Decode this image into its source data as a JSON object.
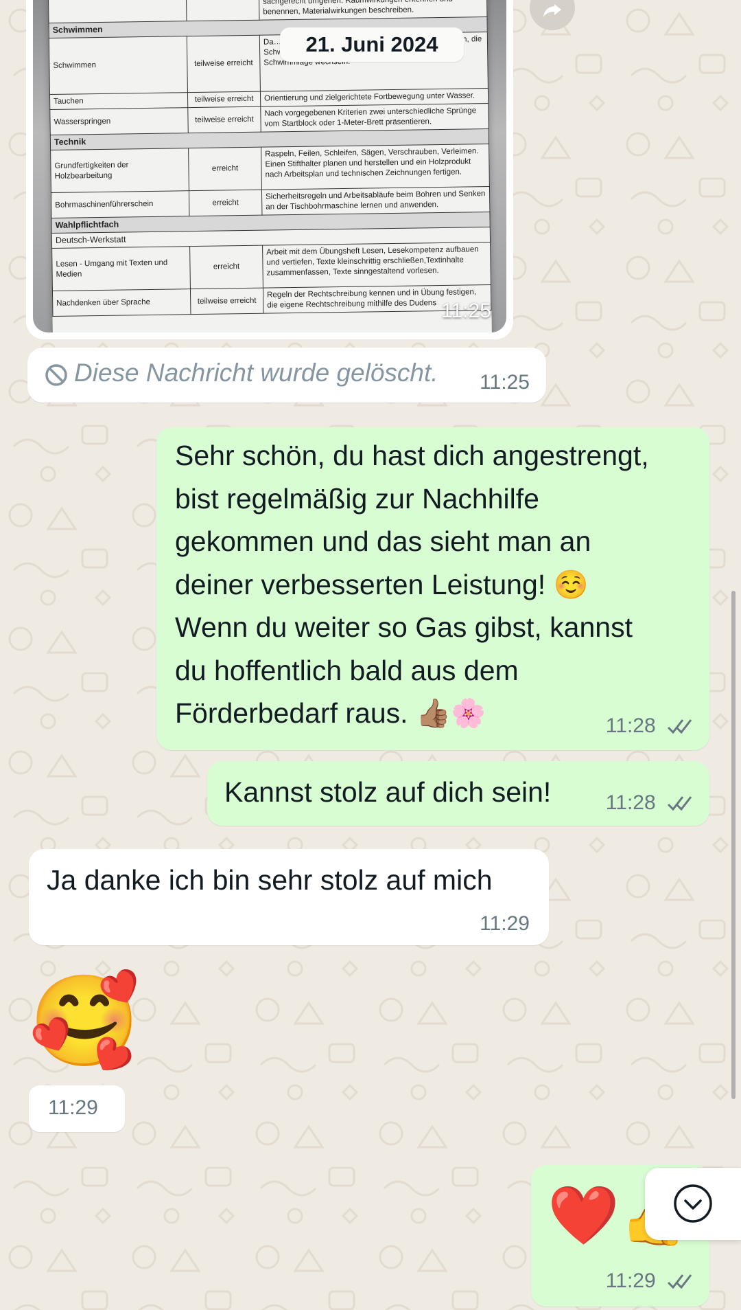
{
  "date_pill": "21. Juni 2024",
  "photo_message": {
    "time": "11:25",
    "document_rows": [
      {
        "type": "text",
        "name": "",
        "status": "",
        "desc": "sachgerecht umgehen. Raumwirkungen erkennen und benennen, Materialwirkungen beschreiben."
      },
      {
        "type": "section",
        "label": "Schwimmen"
      },
      {
        "type": "row",
        "name": "Schwimmen",
        "status": "teilweise erreicht",
        "desc": "Da… einen … vom Beckenrand oder Startblock ausführen, die Schwimmfähigkeit richtig einschätzen und bei Bedarf die Schwimmlage wechseln."
      },
      {
        "type": "row",
        "name": "Tauchen",
        "status": "teilweise erreicht",
        "desc": "Orientierung und zielgerichtete Fortbewegung unter Wasser."
      },
      {
        "type": "row",
        "name": "Wasserspringen",
        "status": "teilweise erreicht",
        "desc": "Nach vorgegebenen Kriterien zwei unterschiedliche Sprünge vom Startblock oder 1-Meter-Brett präsentieren."
      },
      {
        "type": "section",
        "label": "Technik"
      },
      {
        "type": "row",
        "name": "Grundfertigkeiten der Holzbearbeitung",
        "status": "erreicht",
        "desc": "Raspeln, Feilen, Schleifen, Sägen, Verschrauben, Verleimen. Einen Stifthalter planen und herstellen und ein Holzprodukt nach Arbeitsplan und technischen Zeichnungen fertigen."
      },
      {
        "type": "row",
        "name": "Bohrmaschinenführerschein",
        "status": "erreicht",
        "desc": "Sicherheitsregeln und Arbeitsabläufe beim Bohren und Senken an der Tischbohrmaschine lernen und anwenden."
      },
      {
        "type": "section",
        "label": "Wahlpflichtfach"
      },
      {
        "type": "subsection",
        "label": "Deutsch-Werkstatt"
      },
      {
        "type": "row",
        "name": "Lesen - Umgang mit Texten und Medien",
        "status": "erreicht",
        "desc": "Arbeit mit dem Übungsheft Lesen, Lesekompetenz aufbauen und vertiefen, Texte kleinschrittig erschließen,Textinhalte zusammenfassen, Texte sinngestaltend vorlesen."
      },
      {
        "type": "row",
        "name": "Nachdenken über Sprache",
        "status": "teilweise erreicht",
        "desc": "Regeln der Rechtschreibung kennen und in Übung festigen, die eigene Rechtschreibung mithilfe des Dudens"
      }
    ]
  },
  "deleted_message": {
    "text": "Diese Nachricht wurde gelöscht.",
    "time": "11:25"
  },
  "outgoing_1": {
    "lines": [
      "Sehr schön, du hast dich angestrengt,",
      "bist regelmäßig zur Nachhilfe",
      "gekommen und das sieht man an",
      "deiner verbesserten Leistung! ☺️",
      "Wenn du weiter so Gas gibst, kannst",
      "du hoffentlich bald aus dem",
      "Förderbedarf raus. 👍🏽🌸"
    ],
    "time": "11:28"
  },
  "outgoing_2": {
    "text": "Kannst stolz auf dich sein!",
    "time": "11:28"
  },
  "incoming_1": {
    "text": "Ja danke ich bin sehr stolz auf mich",
    "time": "11:29"
  },
  "incoming_emoji": {
    "emoji": "🥰",
    "time": "11:29"
  },
  "outgoing_emoji": {
    "emoji": "❤️👍",
    "time": "11:29"
  },
  "icons": {
    "scroll_down": "chevron-down-circle-icon",
    "deleted": "ban-icon",
    "read_receipt": "double-check-icon",
    "forward": "forward-icon"
  },
  "colors": {
    "background": "#efeae2",
    "incoming_bubble": "#ffffff",
    "outgoing_bubble": "#d9fdd3",
    "read_ticks": "#667781"
  }
}
